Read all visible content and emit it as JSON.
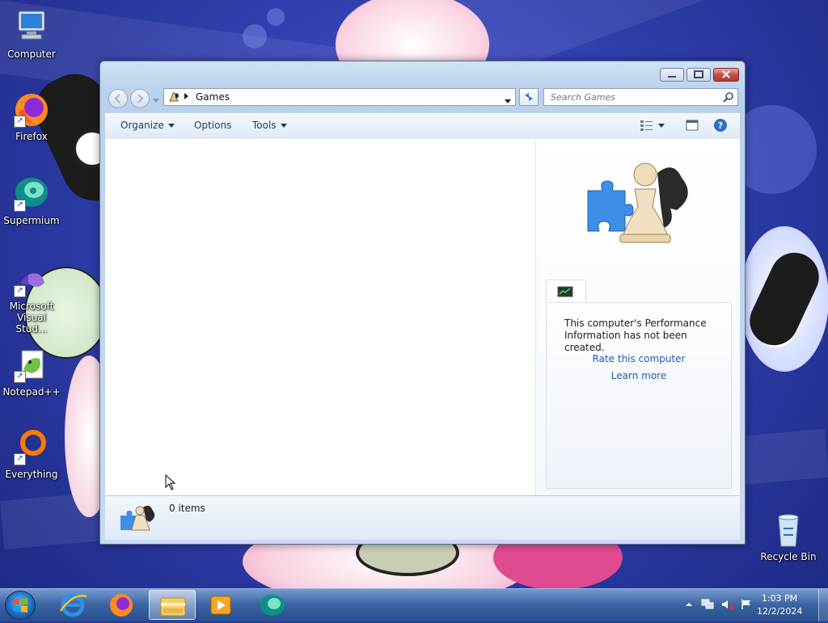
{
  "desktop": {
    "icons": [
      {
        "label": "Computer",
        "icon": "computer-icon"
      },
      {
        "label": "Firefox",
        "icon": "firefox-icon"
      },
      {
        "label": "Supermium",
        "icon": "supermium-icon"
      },
      {
        "label": "Microsoft Visual Stud...",
        "icon": "visual-studio-icon"
      },
      {
        "label": "Notepad++",
        "icon": "notepadpp-icon"
      },
      {
        "label": "Everything",
        "icon": "everything-icon"
      },
      {
        "label": "Recycle Bin",
        "icon": "recycle-bin-icon"
      }
    ]
  },
  "window": {
    "breadcrumb": "Games",
    "search_placeholder": "Search Games",
    "toolbar": {
      "organize": "Organize",
      "options": "Options",
      "tools": "Tools"
    },
    "preview": {
      "perf_message": "This computer's Performance Information has not been created.",
      "rate_link": "Rate this computer",
      "learn_link": "Learn more"
    },
    "details": {
      "item_count": "0 items"
    }
  },
  "taskbar": {
    "apps": [
      "internet-explorer-icon",
      "firefox-icon",
      "windows-explorer-icon",
      "media-player-icon",
      "supermium-icon"
    ],
    "clock": {
      "time": "1:03 PM",
      "date": "12/2/2024"
    }
  },
  "colors": {
    "link": "#1a5fb4",
    "wallpaper": "#3140b0",
    "close_button": "#c75050"
  }
}
